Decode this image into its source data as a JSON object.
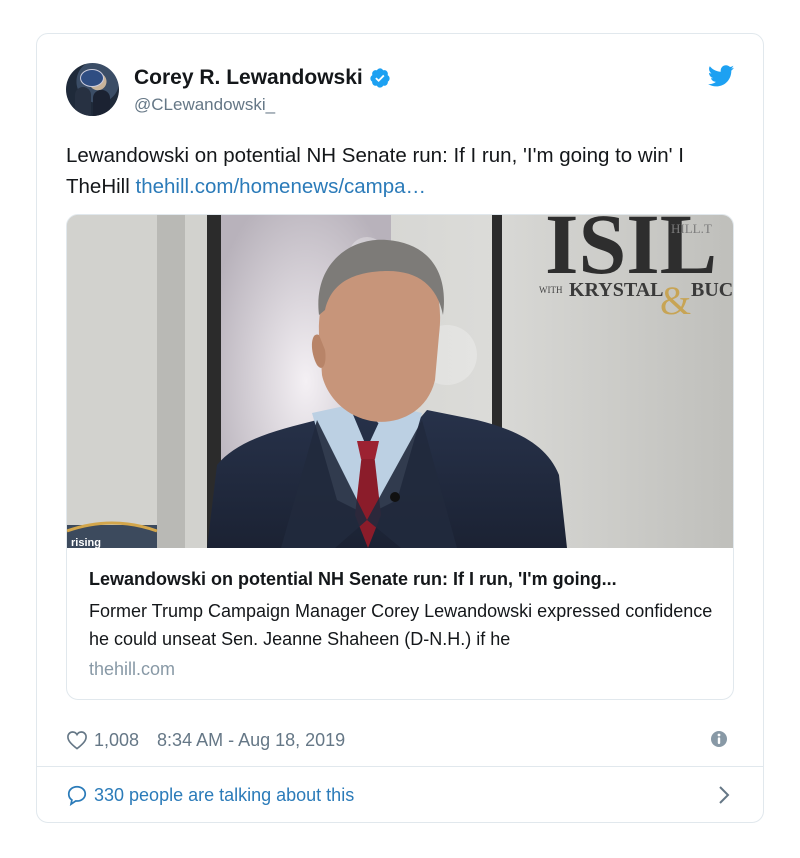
{
  "tweet": {
    "author_name": "Corey R. Lewandowski",
    "author_handle": "@CLewandowski_",
    "text_main": "Lewandowski on potential NH Senate run: If I run, 'I'm going to win' I TheHill ",
    "text_link": "thehill.com/homenews/campa…",
    "likes": "1,008",
    "timestamp": "8:34 AM - Aug 18, 2019",
    "conversation": "330 people are talking about this"
  },
  "link_card": {
    "title": "Lewandowski on potential NH Senate run: If I run, 'I'm going...",
    "description": "Former Trump Campaign Manager Corey Lewandowski expressed confidence he could unseat Sen. Jeanne Shaheen (D-N.H.) if he",
    "domain": "thehill.com",
    "image_overlay": {
      "top_text": "ISIL",
      "corner_text": "HILL.T",
      "with_label": "WITH",
      "host_text": "KRYSTAL",
      "ampersand": "&",
      "host2_text": "BUC",
      "bottom_left_text": "rising"
    }
  },
  "icons": {
    "verified": "verified-badge-icon",
    "brand": "twitter-bird-icon",
    "like": "heart-icon",
    "info": "info-icon",
    "reply": "speech-bubble-icon",
    "chevron": "chevron-right-icon"
  },
  "colors": {
    "link": "#2b7bb9",
    "brand_blue": "#1da1f2",
    "secondary_text": "#657786",
    "border": "#e1e8ed"
  }
}
